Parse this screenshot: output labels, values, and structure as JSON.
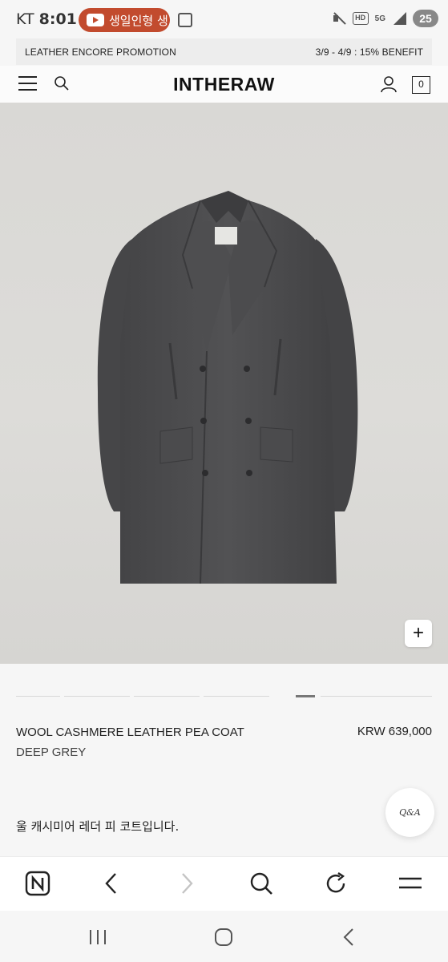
{
  "status_bar": {
    "carrier": "KT",
    "time": "8:01",
    "notification_text": "생일인형 생",
    "battery": "25",
    "network": "5G",
    "hd_label": "HD"
  },
  "promo": {
    "title": "LEATHER ENCORE PROMOTION",
    "benefit": "3/9 - 4/9 : 15% BENEFIT"
  },
  "header": {
    "logo": "INTHERAW",
    "cart_count": "0"
  },
  "gallery": {
    "zoom_label": "+",
    "slide_count": 6,
    "active_slide": 5
  },
  "product": {
    "name": "WOOL CASHMERE LEATHER PEA COAT",
    "color": "DEEP GREY",
    "price": "KRW 639,000",
    "description": "울 캐시미어 레더 피 코트입니다.",
    "qa_label": "Q&A"
  },
  "icons": {
    "menu": "hamburger-icon",
    "search": "search-icon",
    "user": "user-icon",
    "naver": "naver-n-icon",
    "back": "chevron-left-icon",
    "forward": "chevron-right-icon",
    "browser_search": "search-icon",
    "refresh": "refresh-icon",
    "more": "menu-icon",
    "recents": "recents-icon",
    "home": "home-icon",
    "nav_back": "back-icon"
  },
  "colors": {
    "coat": "#4a4a4c",
    "background": "#dad9d6"
  }
}
